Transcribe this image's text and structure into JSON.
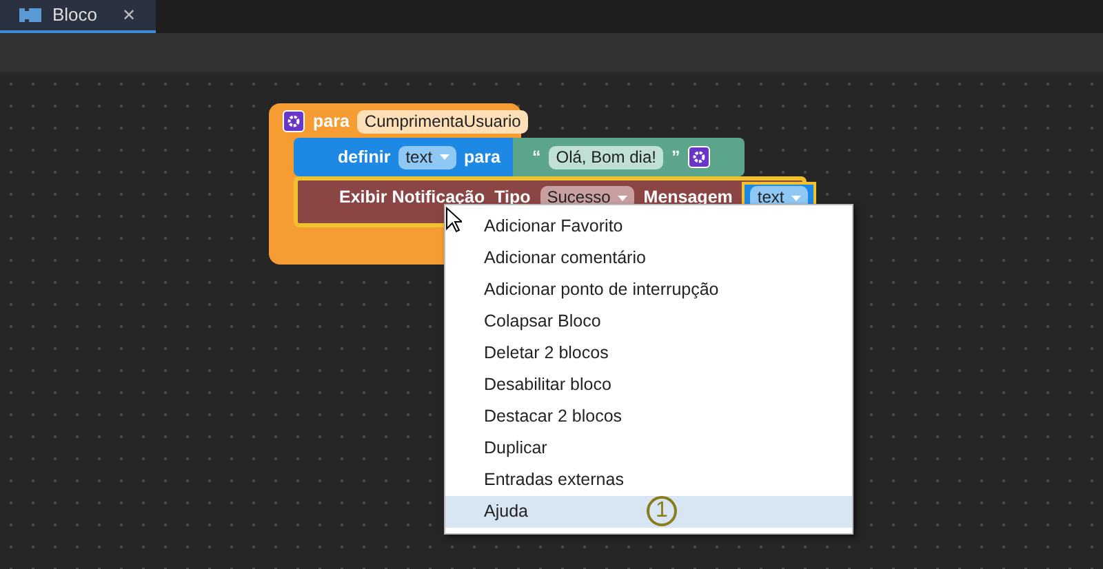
{
  "tabs": [
    {
      "label": "Bloco",
      "close": "✕",
      "selected": true
    }
  ],
  "blocks": {
    "procedure": {
      "keyword": "para",
      "name": "CumprimentaUsuario"
    },
    "set": {
      "keyword": "definir",
      "variable": "text",
      "to": "para"
    },
    "string": {
      "open_quote": "“",
      "value": "Olá, Bom dia!",
      "close_quote": "”"
    },
    "notify": {
      "label": "Exibir Notificação",
      "type_label": "Tipo",
      "type_value": "Sucesso",
      "message_label": "Mensagem",
      "message_value": "text"
    }
  },
  "context_menu": {
    "items": [
      {
        "label": "Adicionar Favorito",
        "selected": false
      },
      {
        "label": "Adicionar comentário",
        "selected": false
      },
      {
        "label": "Adicionar ponto de interrupção",
        "selected": false
      },
      {
        "label": "Colapsar Bloco",
        "selected": false
      },
      {
        "label": "Deletar 2 blocos",
        "selected": false
      },
      {
        "label": "Desabilitar bloco",
        "selected": false
      },
      {
        "label": "Destacar 2 blocos",
        "selected": false
      },
      {
        "label": "Duplicar",
        "selected": false
      },
      {
        "label": "Entradas externas",
        "selected": false
      },
      {
        "label": "Ajuda",
        "selected": true
      }
    ]
  },
  "annotation": "1"
}
